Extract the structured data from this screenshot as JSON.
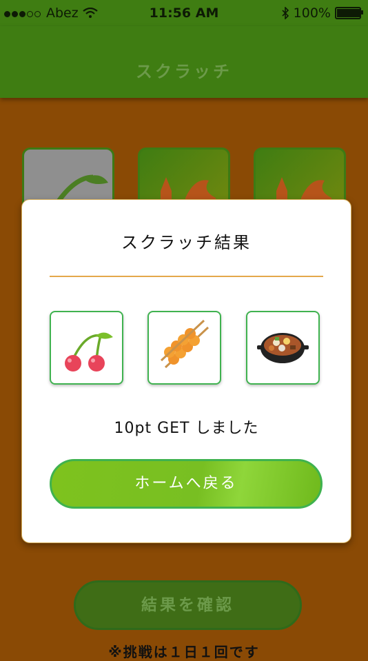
{
  "status_bar": {
    "carrier": "Abez",
    "time": "11:56 AM",
    "battery_text": "100%",
    "battery_level": 1.0,
    "signal_icon": "signal-dots-icon",
    "wifi_icon": "wifi-icon",
    "bluetooth_icon": "bluetooth-icon"
  },
  "header": {
    "title": "スクラッチ"
  },
  "modal": {
    "title": "スクラッチ結果",
    "results": [
      {
        "icon": "cherry-icon"
      },
      {
        "icon": "dango-icon"
      },
      {
        "icon": "nabe-stew-icon"
      }
    ],
    "message": "10pt GET しました",
    "home_button": "ホームへ戻る"
  },
  "confirm_button": "結果を確認",
  "note": "※挑戦は１日１回です",
  "colors": {
    "header_green": "#3f7d12",
    "background_brown": "#8a4a05",
    "accent_green": "#3fb24f",
    "button_green": "#7ec21e",
    "divider_orange": "#e4a84a"
  }
}
